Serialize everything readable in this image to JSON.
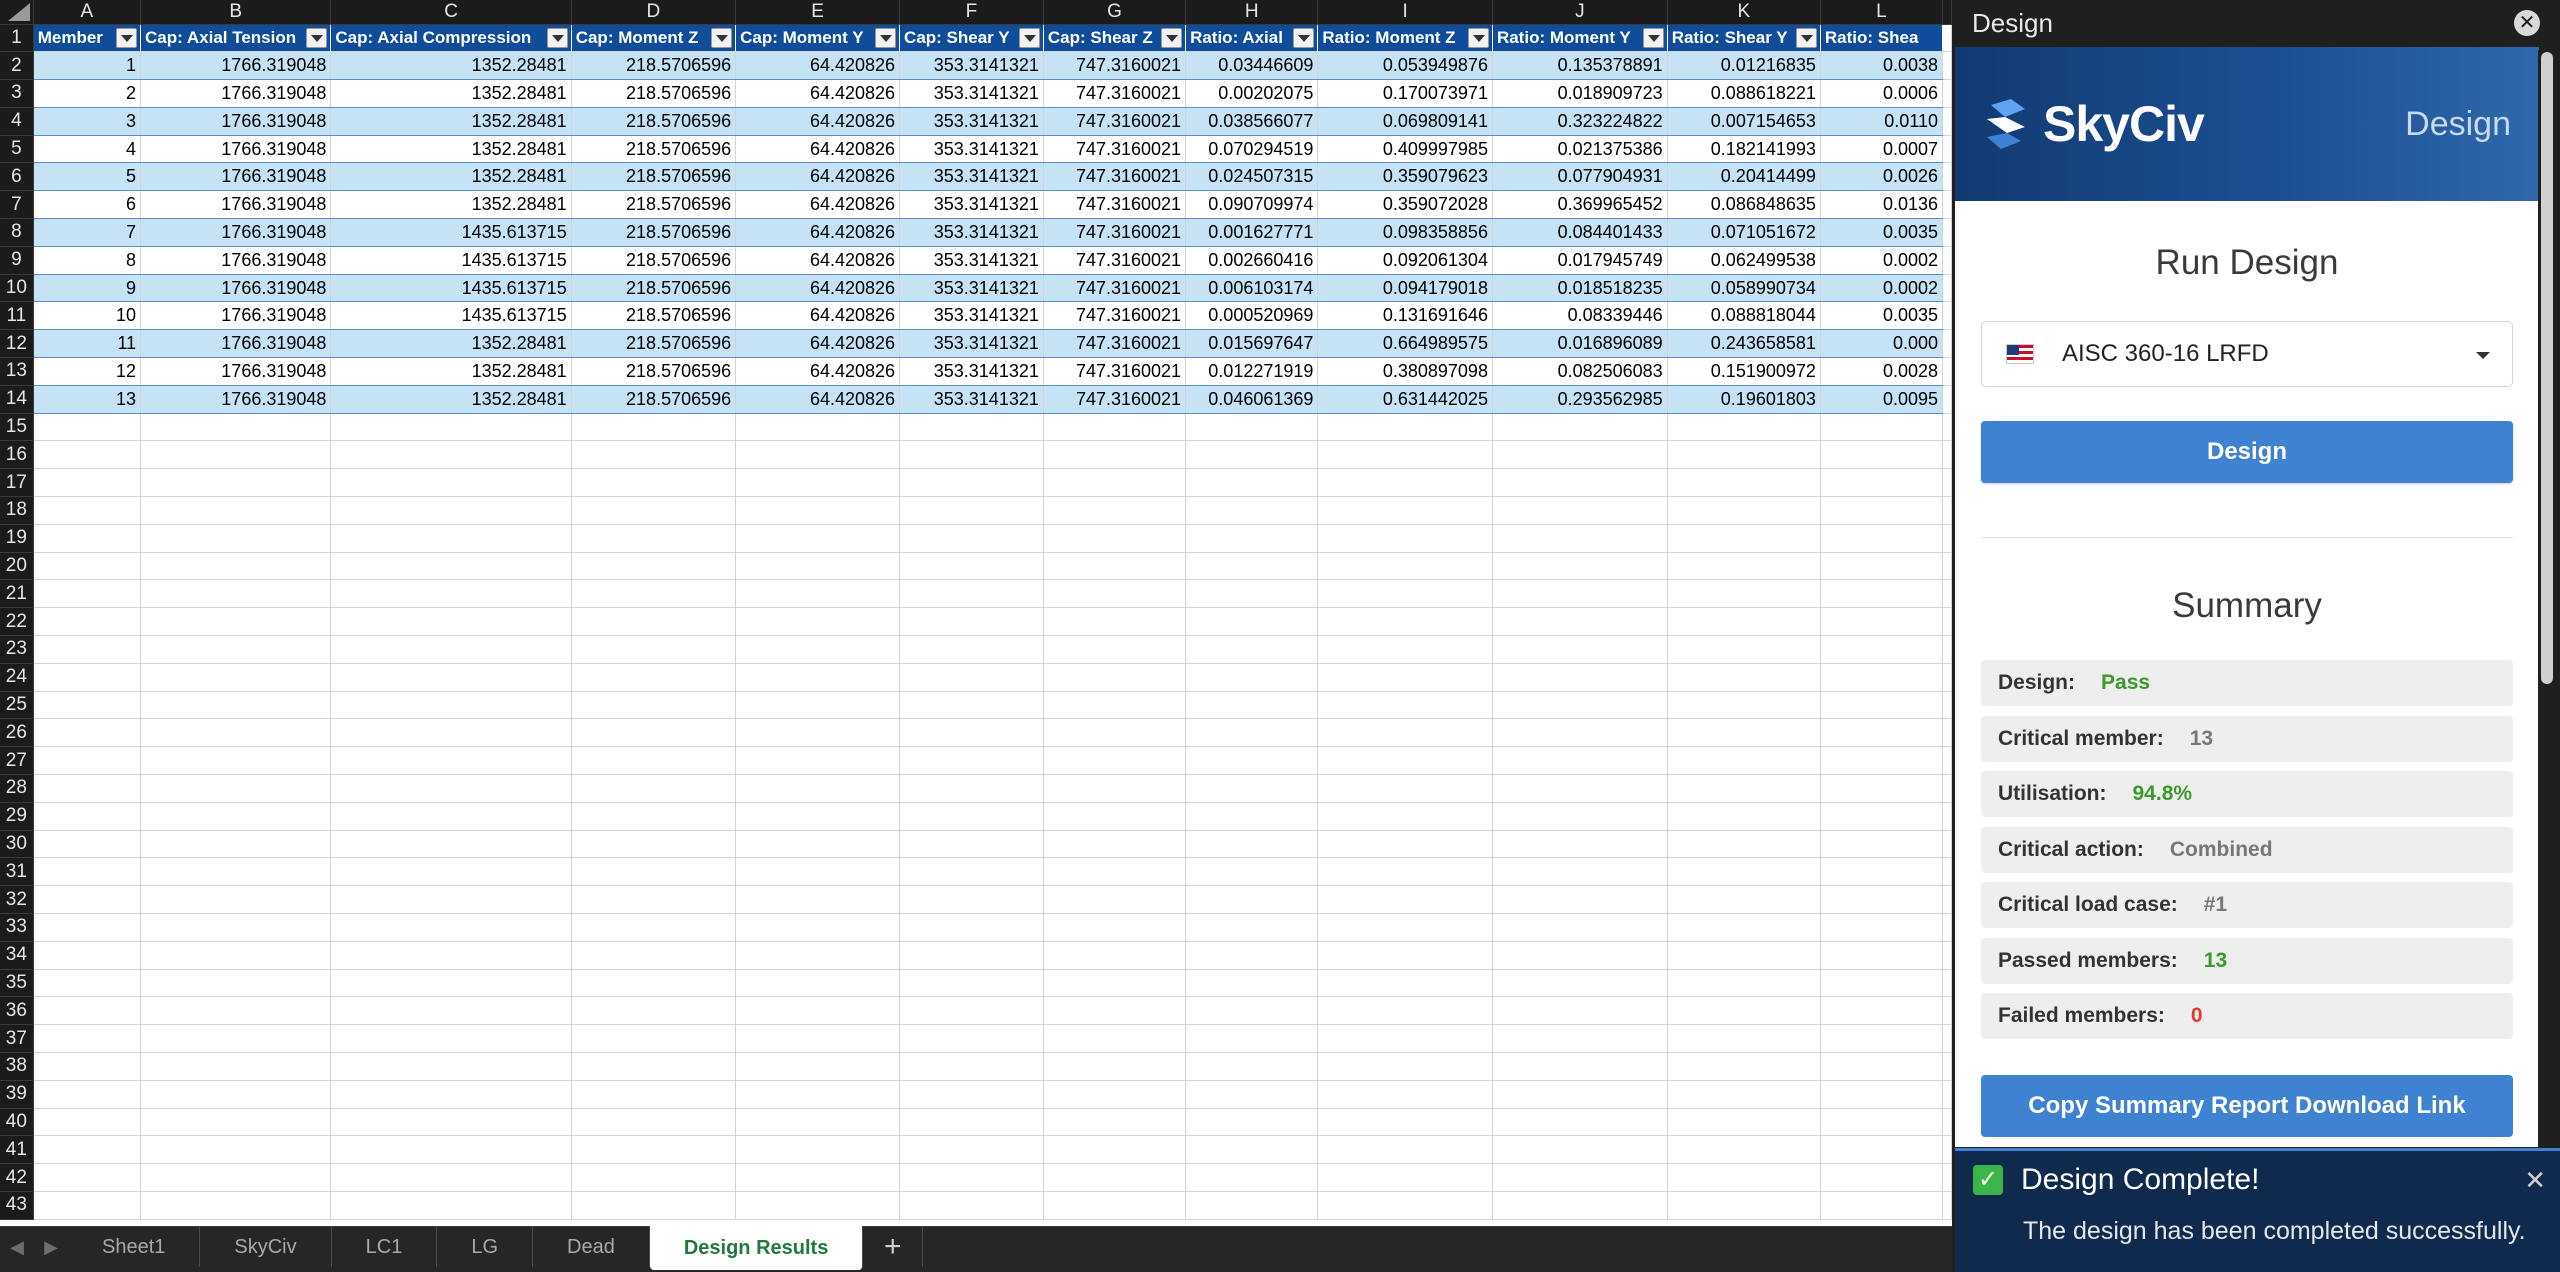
{
  "spreadsheet": {
    "column_letters": [
      "A",
      "B",
      "C",
      "D",
      "E",
      "F",
      "G",
      "H",
      "I",
      "J",
      "K",
      "L"
    ],
    "headers": [
      "Member",
      "Cap: Axial Tension",
      "Cap: Axial Compression",
      "Cap: Moment Z",
      "Cap: Moment Y",
      "Cap: Shear Y",
      "Cap: Shear Z",
      "Ratio: Axial",
      "Ratio: Moment Z",
      "Ratio: Moment Y",
      "Ratio: Shear Y",
      "Ratio: Shea"
    ],
    "rows": [
      [
        "1",
        "1766.319048",
        "1352.28481",
        "218.5706596",
        "64.420826",
        "353.3141321",
        "747.3160021",
        "0.03446609",
        "0.053949876",
        "0.135378891",
        "0.01216835",
        "0.0038"
      ],
      [
        "2",
        "1766.319048",
        "1352.28481",
        "218.5706596",
        "64.420826",
        "353.3141321",
        "747.3160021",
        "0.00202075",
        "0.170073971",
        "0.018909723",
        "0.088618221",
        "0.0006"
      ],
      [
        "3",
        "1766.319048",
        "1352.28481",
        "218.5706596",
        "64.420826",
        "353.3141321",
        "747.3160021",
        "0.038566077",
        "0.069809141",
        "0.323224822",
        "0.007154653",
        "0.0110"
      ],
      [
        "4",
        "1766.319048",
        "1352.28481",
        "218.5706596",
        "64.420826",
        "353.3141321",
        "747.3160021",
        "0.070294519",
        "0.409997985",
        "0.021375386",
        "0.182141993",
        "0.0007"
      ],
      [
        "5",
        "1766.319048",
        "1352.28481",
        "218.5706596",
        "64.420826",
        "353.3141321",
        "747.3160021",
        "0.024507315",
        "0.359079623",
        "0.077904931",
        "0.20414499",
        "0.0026"
      ],
      [
        "6",
        "1766.319048",
        "1352.28481",
        "218.5706596",
        "64.420826",
        "353.3141321",
        "747.3160021",
        "0.090709974",
        "0.359072028",
        "0.369965452",
        "0.086848635",
        "0.0136"
      ],
      [
        "7",
        "1766.319048",
        "1435.613715",
        "218.5706596",
        "64.420826",
        "353.3141321",
        "747.3160021",
        "0.001627771",
        "0.098358856",
        "0.084401433",
        "0.071051672",
        "0.0035"
      ],
      [
        "8",
        "1766.319048",
        "1435.613715",
        "218.5706596",
        "64.420826",
        "353.3141321",
        "747.3160021",
        "0.002660416",
        "0.092061304",
        "0.017945749",
        "0.062499538",
        "0.0002"
      ],
      [
        "9",
        "1766.319048",
        "1435.613715",
        "218.5706596",
        "64.420826",
        "353.3141321",
        "747.3160021",
        "0.006103174",
        "0.094179018",
        "0.018518235",
        "0.058990734",
        "0.0002"
      ],
      [
        "10",
        "1766.319048",
        "1435.613715",
        "218.5706596",
        "64.420826",
        "353.3141321",
        "747.3160021",
        "0.000520969",
        "0.131691646",
        "0.08339446",
        "0.088818044",
        "0.0035"
      ],
      [
        "11",
        "1766.319048",
        "1352.28481",
        "218.5706596",
        "64.420826",
        "353.3141321",
        "747.3160021",
        "0.015697647",
        "0.664989575",
        "0.016896089",
        "0.243658581",
        "0.000"
      ],
      [
        "12",
        "1766.319048",
        "1352.28481",
        "218.5706596",
        "64.420826",
        "353.3141321",
        "747.3160021",
        "0.012271919",
        "0.380897098",
        "0.082506083",
        "0.151900972",
        "0.0028"
      ],
      [
        "13",
        "1766.319048",
        "1352.28481",
        "218.5706596",
        "64.420826",
        "353.3141321",
        "747.3160021",
        "0.046061369",
        "0.631442025",
        "0.293562985",
        "0.19601803",
        "0.0095"
      ]
    ],
    "row_numbers": [
      "1",
      "2",
      "3",
      "4",
      "5",
      "6",
      "7",
      "8",
      "9",
      "10",
      "11",
      "12",
      "13",
      "14",
      "15",
      "16",
      "17",
      "18",
      "19",
      "20",
      "21",
      "22",
      "23",
      "24",
      "25",
      "26",
      "27",
      "28",
      "29",
      "30",
      "31",
      "32",
      "33",
      "34",
      "35",
      "36",
      "37",
      "38",
      "39",
      "40",
      "41",
      "42",
      "43"
    ]
  },
  "sheet_tabs": {
    "items": [
      "Sheet1",
      "SkyCiv",
      "LC1",
      "LG",
      "Dead",
      "Design Results"
    ],
    "active": "Design Results",
    "add_label": "+",
    "prev_icon": "◀",
    "next_icon": "▶"
  },
  "pane": {
    "title": "Design",
    "close_glyph": "✕",
    "brand_name": "SkyCiv",
    "brand_right": "Design",
    "run_title": "Run Design",
    "standard": "AISC 360-16 LRFD",
    "design_button": "Design",
    "summary_title": "Summary",
    "summary": [
      {
        "key": "Design:",
        "value": "Pass",
        "tone": "green"
      },
      {
        "key": "Critical member:",
        "value": "13",
        "tone": "grey"
      },
      {
        "key": "Utilisation:",
        "value": "94.8%",
        "tone": "green"
      },
      {
        "key": "Critical action:",
        "value": "Combined",
        "tone": "grey"
      },
      {
        "key": "Critical load case:",
        "value": "#1",
        "tone": "grey"
      },
      {
        "key": "Passed members:",
        "value": "13",
        "tone": "green"
      },
      {
        "key": "Failed members:",
        "value": "0",
        "tone": "red"
      }
    ],
    "copy_button": "Copy Summary Report Download Link"
  },
  "toast": {
    "title": "Design Complete!",
    "message": "The design has been completed successfully.",
    "close_glyph": "✕",
    "check_glyph": "✓"
  },
  "colors": {
    "header_blue": "#0f4c9a",
    "band_blue": "#c6e2f5",
    "button_blue": "#3f82d1",
    "pass_green": "#3a9b2a",
    "fail_red": "#e13b2e"
  }
}
